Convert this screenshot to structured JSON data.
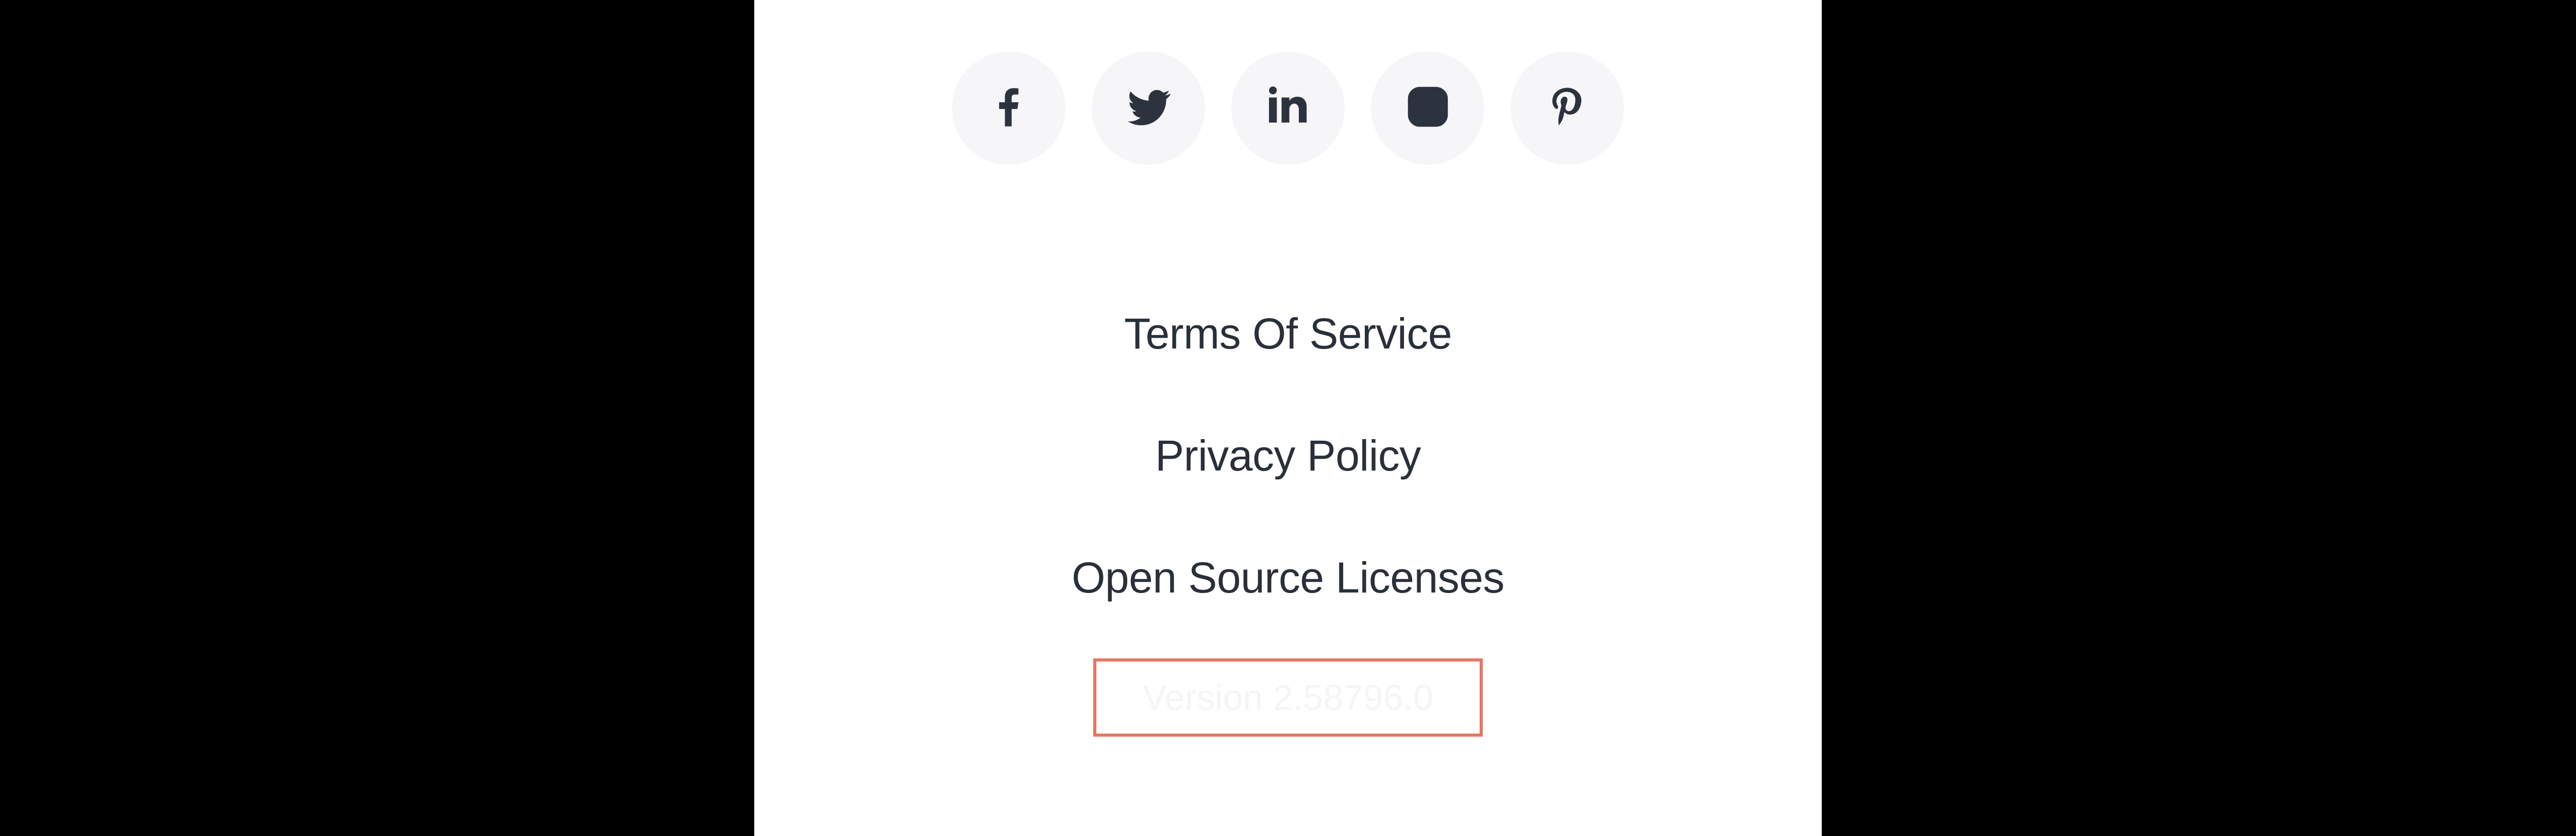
{
  "social_icons": {
    "facebook": "facebook",
    "twitter": "twitter",
    "linkedin": "linkedin",
    "instagram": "instagram",
    "pinterest": "pinterest"
  },
  "links": {
    "terms": "Terms Of Service",
    "privacy": "Privacy Policy",
    "licenses": "Open Source Licenses"
  },
  "version": "Version 2.58796.0"
}
